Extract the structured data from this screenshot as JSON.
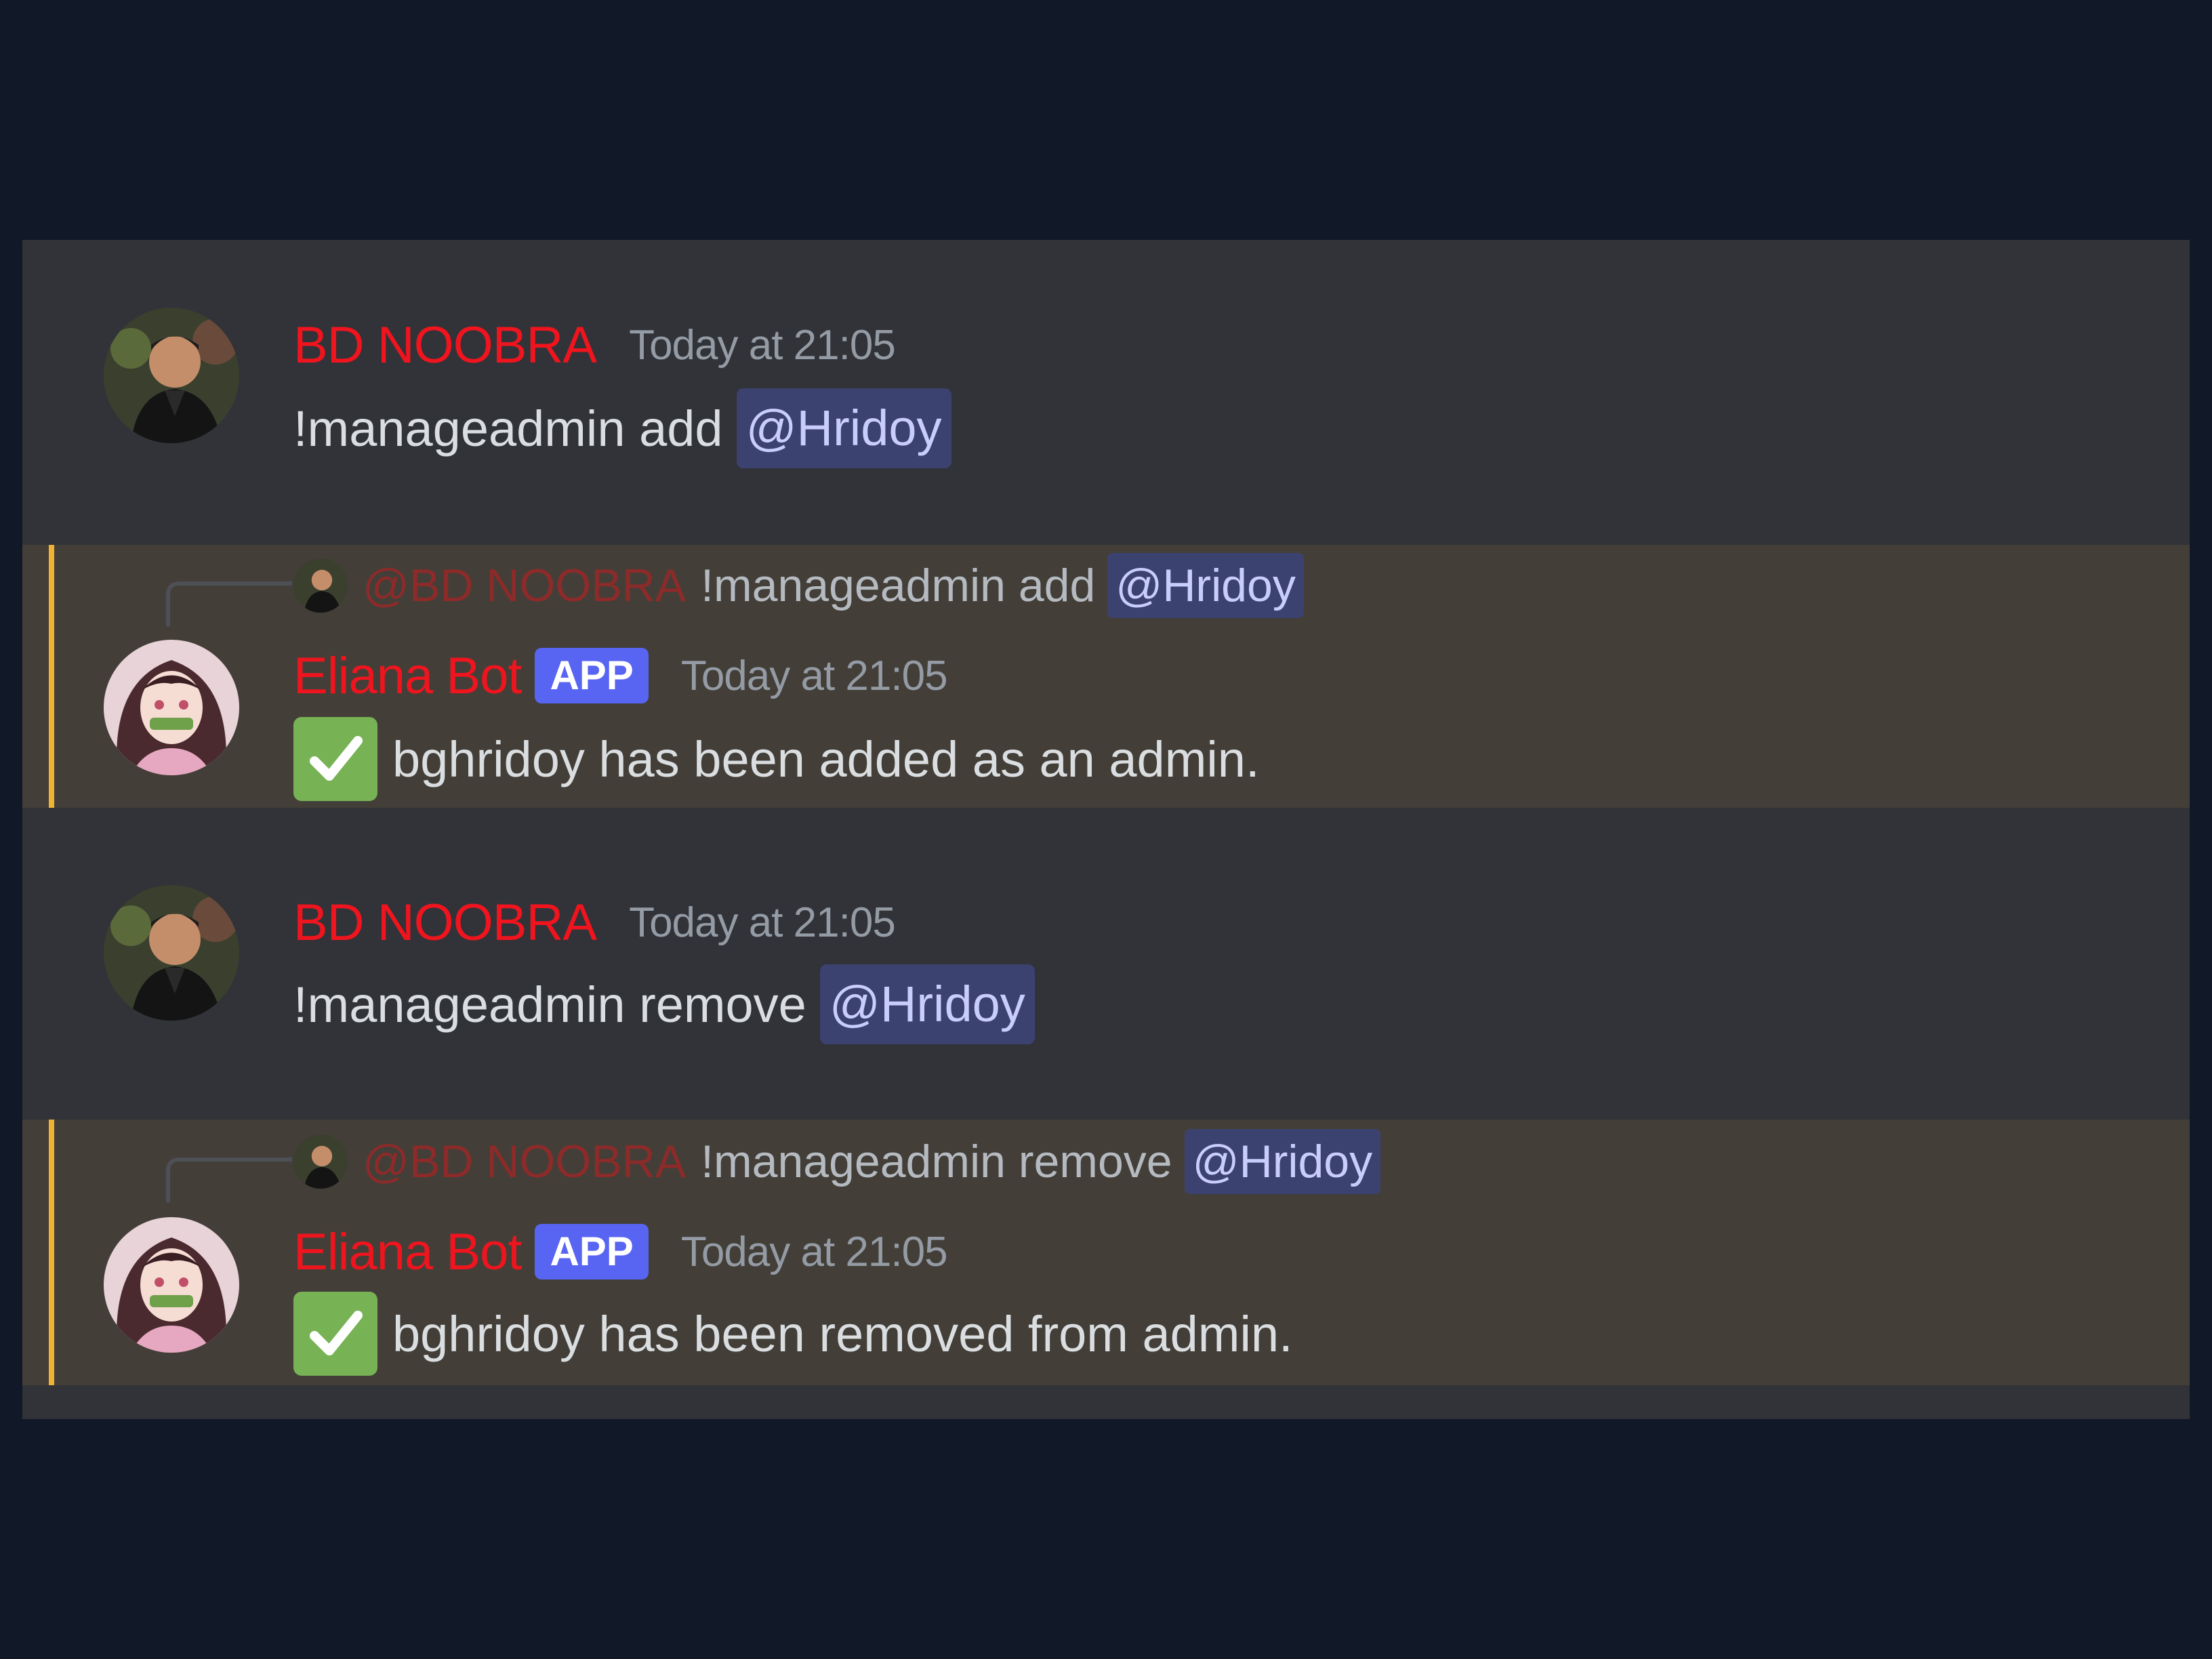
{
  "messages": [
    {
      "type": "user",
      "username": "BD NOOBRA",
      "timestamp": "Today at 21:05",
      "text": "!manageadmin add",
      "mention": "@Hridoy"
    },
    {
      "type": "bot",
      "reply_user": "@BD NOOBRA",
      "reply_text": "!manageadmin add",
      "reply_mention": "@Hridoy",
      "username": "Eliana Bot",
      "badge": "APP",
      "timestamp": "Today at 21:05",
      "text": "bghridoy has been added as an admin."
    },
    {
      "type": "user",
      "username": "BD NOOBRA",
      "timestamp": "Today at 21:05",
      "text": "!manageadmin remove",
      "mention": "@Hridoy"
    },
    {
      "type": "bot",
      "reply_user": "@BD NOOBRA",
      "reply_text": "!manageadmin remove",
      "reply_mention": "@Hridoy",
      "username": "Eliana Bot",
      "badge": "APP",
      "timestamp": "Today at 21:05",
      "text": "bghridoy has been removed from admin."
    }
  ],
  "colors": {
    "page_background": "#111828",
    "chat_background": "#313338",
    "highlight_background": "#433f38",
    "highlight_bar": "#f0b232",
    "username": "#f0141e",
    "mention_background": "#3c4270",
    "app_badge": "#5865f2",
    "check_emoji": "#77b255"
  },
  "icons": {
    "user_avatar": "user-photo-avatar",
    "bot_avatar": "anime-character-avatar",
    "success": "white-check-mark-emoji"
  }
}
